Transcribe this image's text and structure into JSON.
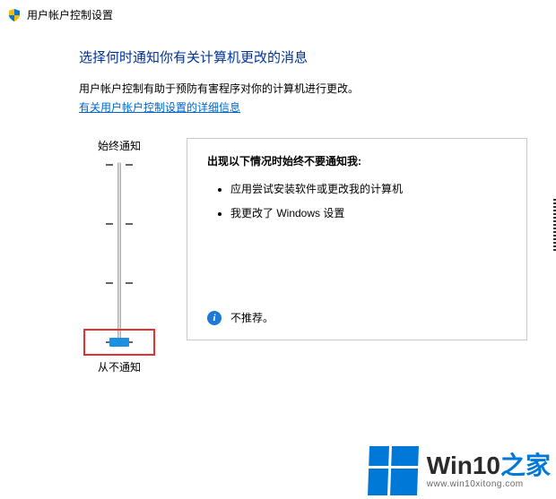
{
  "window": {
    "title": "用户帐户控制设置"
  },
  "main": {
    "heading": "选择何时通知你有关计算机更改的消息",
    "description": "用户帐户控制有助于预防有害程序对你的计算机进行更改。",
    "help_link": "有关用户帐户控制设置的详细信息"
  },
  "slider": {
    "top_label": "始终通知",
    "bottom_label": "从不通知",
    "levels": 4,
    "value": 0
  },
  "panel": {
    "heading": "出现以下情况时始终不要通知我:",
    "items": [
      "应用尝试安装软件或更改我的计算机",
      "我更改了 Windows 设置"
    ],
    "note": "不推荐。",
    "info_glyph": "i"
  },
  "watermark": {
    "brand_main": "Win10",
    "brand_suffix": "之家",
    "url": "www.win10xitong.com"
  }
}
